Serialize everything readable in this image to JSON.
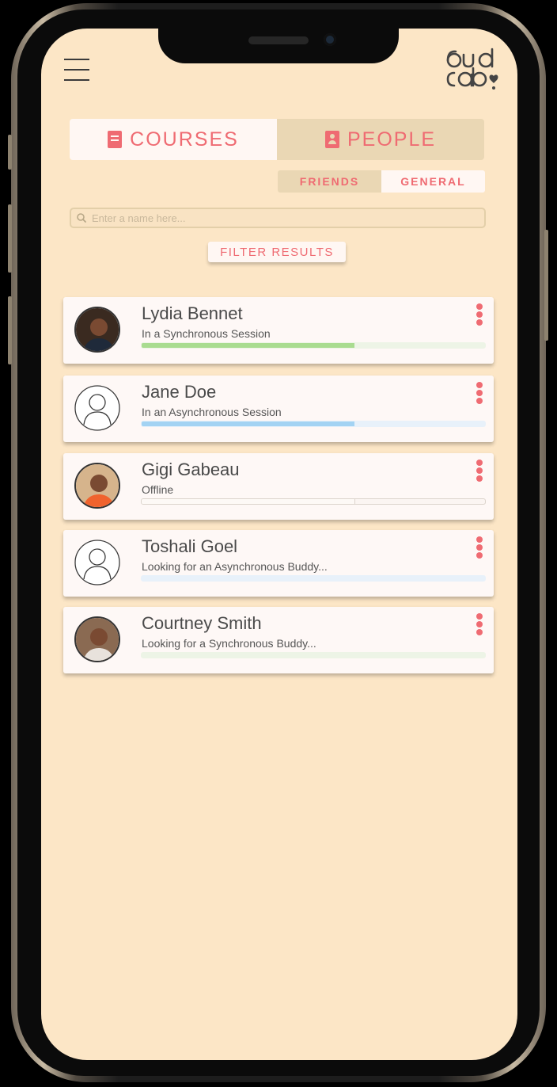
{
  "colors": {
    "accent": "#ef6b72",
    "background": "#fce6c6",
    "card": "#fef8f6",
    "tab_inactive": "#ead7b4",
    "sync_green": "#a9dc90",
    "async_blue": "#a3d3f3"
  },
  "app": {
    "logo_alt": "bud lab"
  },
  "header": {
    "menu_icon": "hamburger-menu-icon"
  },
  "tabs": [
    {
      "label": "COURSES",
      "icon": "book-icon",
      "active": false
    },
    {
      "label": "PEOPLE",
      "icon": "contacts-icon",
      "active": true
    }
  ],
  "subtabs": [
    {
      "label": "FRIENDS",
      "active": true
    },
    {
      "label": "GENERAL",
      "active": false
    }
  ],
  "search": {
    "placeholder": "Enter a name here...",
    "value": "",
    "icon": "search-icon"
  },
  "filter": {
    "label": "FILTER RESULTS"
  },
  "people": [
    {
      "name": "Lydia Bennet",
      "status": "In a Synchronous Session",
      "avatar": "photo",
      "progress": 0.62,
      "bar_color": "#a9dc90",
      "track_color": "#edf4e6"
    },
    {
      "name": "Jane Doe",
      "status": "In an Asynchronous Session",
      "avatar": "placeholder",
      "progress": 0.62,
      "bar_color": "#a3d3f3",
      "track_color": "#e8f1fa"
    },
    {
      "name": "Gigi Gabeau",
      "status": "Offline",
      "avatar": "photo",
      "progress": 0.62,
      "bar_color": "#fdf9f6",
      "track_color": "#fbf5f2"
    },
    {
      "name": "Toshali Goel",
      "status": "Looking for an Asynchronous Buddy...",
      "avatar": "placeholder",
      "progress": 0.0,
      "bar_color": "#a3d3f3",
      "track_color": "#e8f1fa"
    },
    {
      "name": "Courtney Smith",
      "status": "Looking for a Synchronous Buddy...",
      "avatar": "photo",
      "progress": 0.0,
      "bar_color": "#a9dc90",
      "track_color": "#edf4e6"
    }
  ]
}
